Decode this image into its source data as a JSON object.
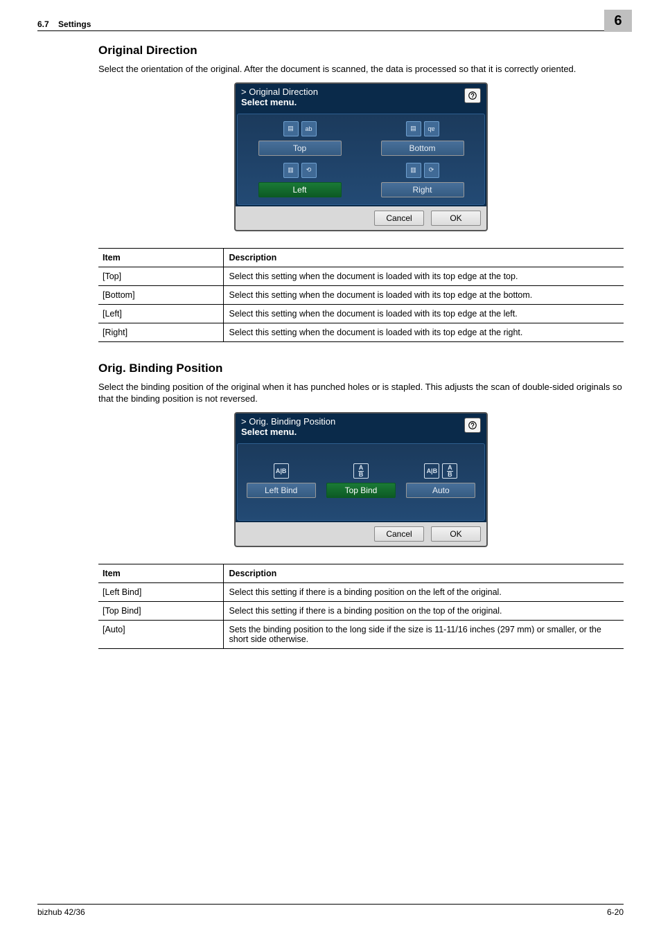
{
  "header": {
    "section_number": "6.7",
    "section_title": "Settings",
    "chapter_badge": "6"
  },
  "sections": [
    {
      "title": "Original Direction",
      "description": "Select the orientation of the original. After the document is scanned, the data is processed so that it is correctly oriented.",
      "panel": {
        "breadcrumb": "Original Direction",
        "select_menu": "Select menu.",
        "options": [
          {
            "label": "Top",
            "selected": false
          },
          {
            "label": "Bottom",
            "selected": false
          },
          {
            "label": "Left",
            "selected": true
          },
          {
            "label": "Right",
            "selected": false
          }
        ],
        "cancel": "Cancel",
        "ok": "OK"
      },
      "table": {
        "headers": [
          "Item",
          "Description"
        ],
        "rows": [
          [
            "[Top]",
            "Select this setting when the document is loaded with its top edge at the top."
          ],
          [
            "[Bottom]",
            "Select this setting when the document is loaded with its top edge at the bottom."
          ],
          [
            "[Left]",
            "Select this setting when the document is loaded with its top edge at the left."
          ],
          [
            "[Right]",
            "Select this setting when the document is loaded with its top edge at the right."
          ]
        ]
      }
    },
    {
      "title": "Orig. Binding Position",
      "description": "Select the binding position of the original when it has punched holes or is stapled. This adjusts the scan of double-sided originals so that the binding position is not reversed.",
      "panel": {
        "breadcrumb": "Orig. Binding Position",
        "select_menu": "Select menu.",
        "options": [
          {
            "label": "Left Bind",
            "selected": false
          },
          {
            "label": "Top Bind",
            "selected": true
          },
          {
            "label": "Auto",
            "selected": false
          }
        ],
        "cancel": "Cancel",
        "ok": "OK"
      },
      "table": {
        "headers": [
          "Item",
          "Description"
        ],
        "rows": [
          [
            "[Left Bind]",
            "Select this setting if there is a binding position on the left of the original."
          ],
          [
            "[Top Bind]",
            "Select this setting if there is a binding position on the top of the original."
          ],
          [
            "[Auto]",
            "Sets the binding position to the long side if the size is 11-11/16 inches (297 mm) or smaller, or the short side otherwise."
          ]
        ]
      }
    }
  ],
  "footer": {
    "product": "bizhub 42/36",
    "page_number": "6-20"
  }
}
